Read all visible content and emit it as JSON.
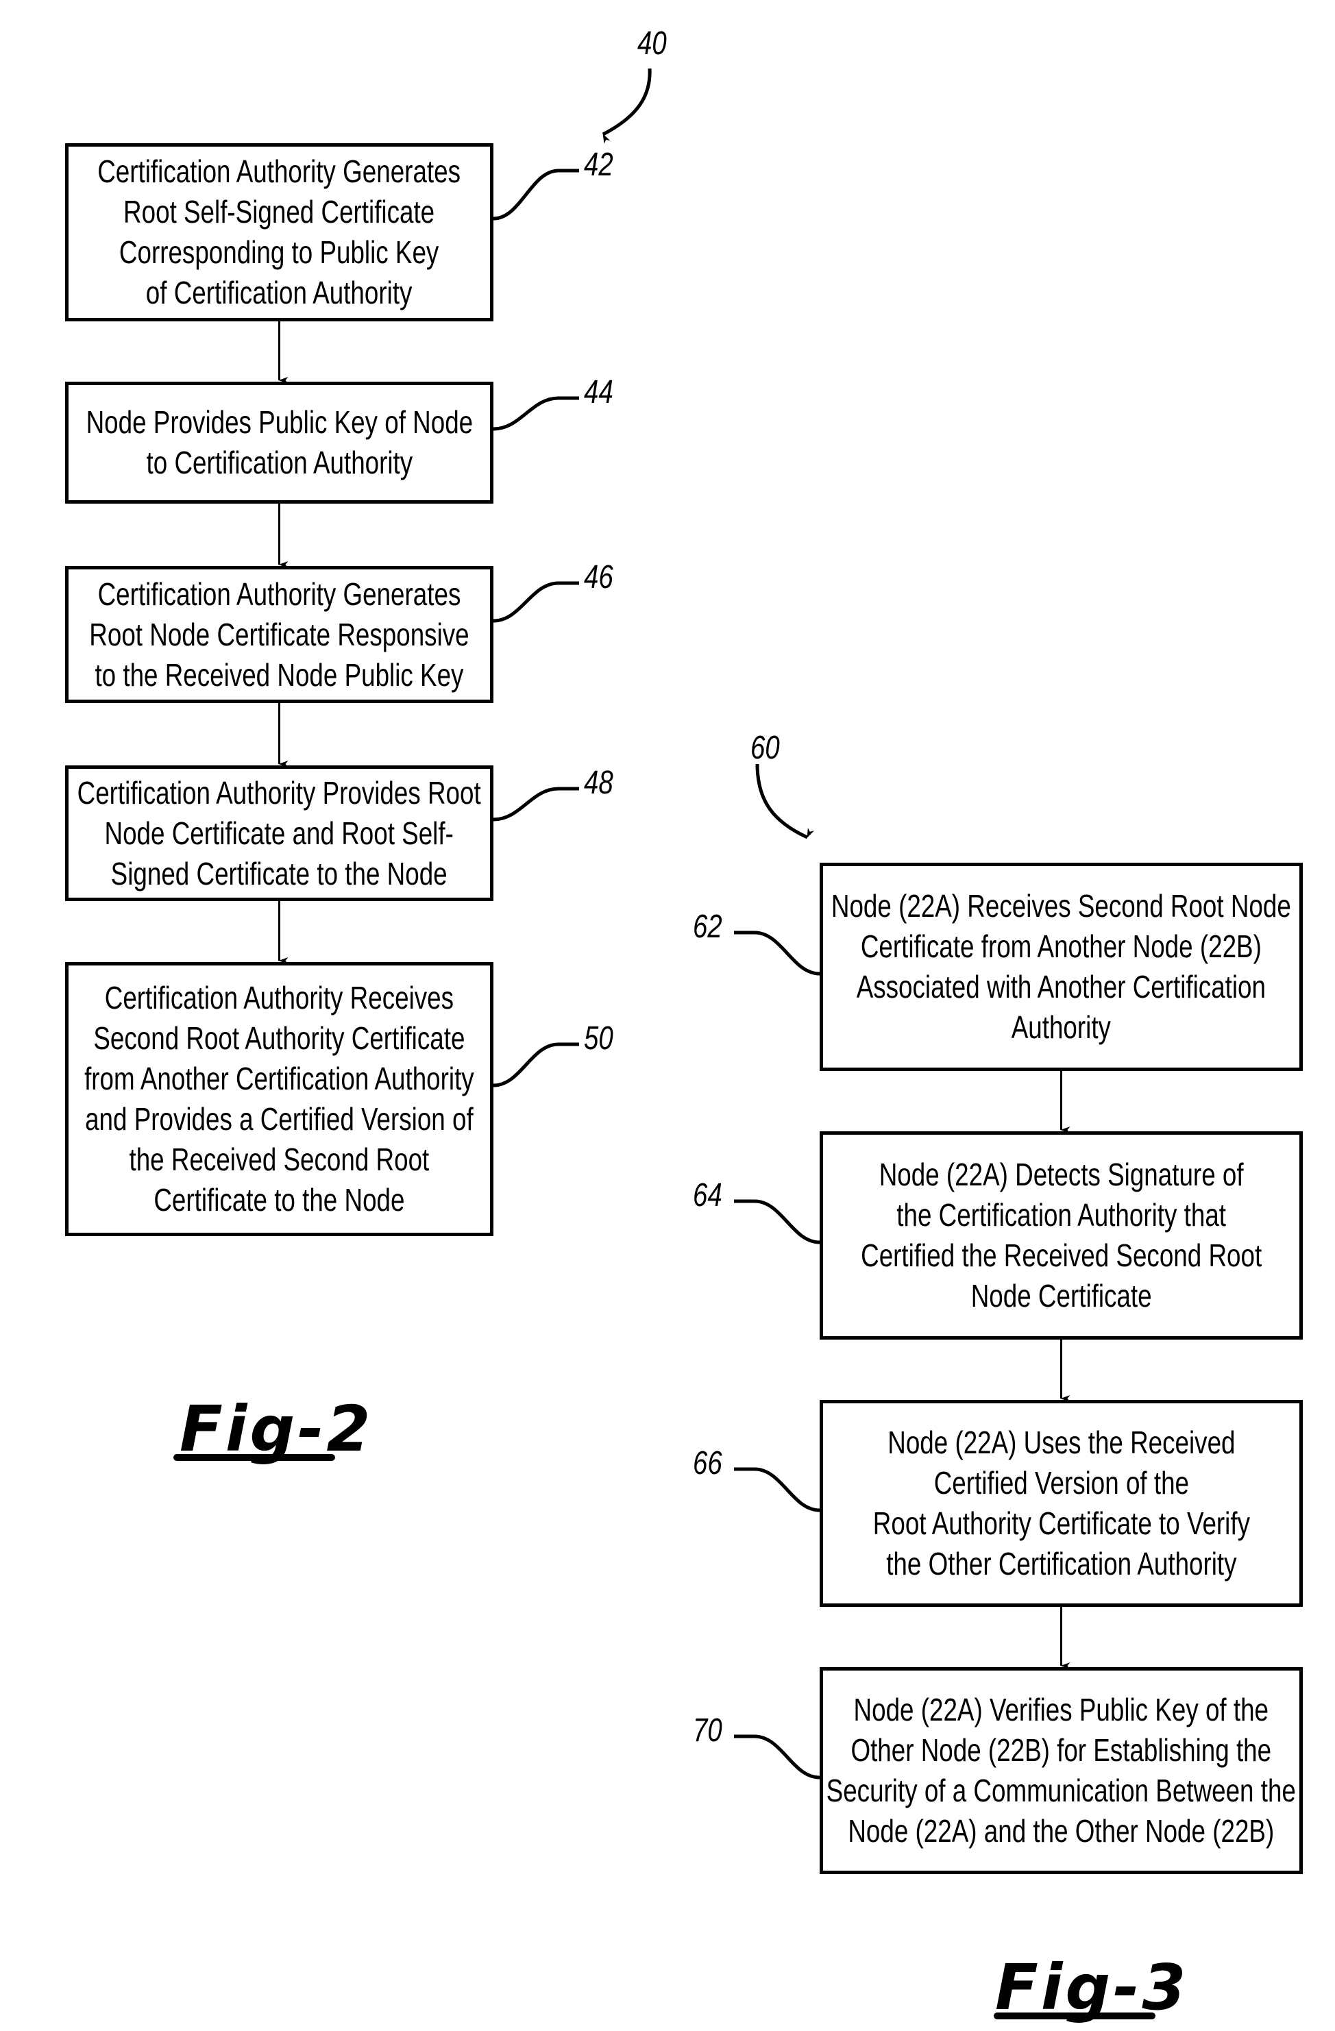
{
  "figures": [
    {
      "id": "fig2",
      "caption": "Fig-2",
      "ref": "40",
      "steps": [
        {
          "ref": "42",
          "lines": [
            "Certification Authority Generates",
            "Root Self-Signed Certificate",
            "Corresponding to Public Key",
            "of Certification Authority"
          ]
        },
        {
          "ref": "44",
          "lines": [
            "Node Provides Public Key of Node",
            "to Certification Authority"
          ]
        },
        {
          "ref": "46",
          "lines": [
            "Certification Authority Generates",
            "Root Node Certificate Responsive",
            "to the Received Node Public Key"
          ]
        },
        {
          "ref": "48",
          "lines": [
            "Certification Authority Provides Root",
            "Node Certificate and Root Self-",
            "Signed Certificate to the Node"
          ]
        },
        {
          "ref": "50",
          "lines": [
            "Certification Authority Receives",
            "Second Root Authority Certificate",
            "from Another Certification Authority",
            "and Provides a Certified Version of",
            "the Received Second Root",
            "Certificate to the Node"
          ]
        }
      ]
    },
    {
      "id": "fig3",
      "caption": "Fig-3",
      "ref": "60",
      "steps": [
        {
          "ref": "62",
          "lines": [
            "Node (22A) Receives Second Root Node",
            "Certificate from Another Node (22B)",
            "Associated with Another Certification",
            "Authority"
          ]
        },
        {
          "ref": "64",
          "lines": [
            "Node (22A) Detects Signature of",
            "the Certification Authority that",
            "Certified the Received Second Root",
            "Node Certificate"
          ]
        },
        {
          "ref": "66",
          "lines": [
            "Node (22A) Uses the Received",
            "Certified Version of the",
            "Root Authority Certificate to Verify",
            "the Other Certification Authority"
          ]
        },
        {
          "ref": "70",
          "lines": [
            "Node (22A) Verifies Public Key of the",
            "Other Node (22B) for Establishing the",
            "Security of a Communication Between the",
            "Node (22A) and the Other Node (22B)"
          ]
        }
      ]
    }
  ]
}
